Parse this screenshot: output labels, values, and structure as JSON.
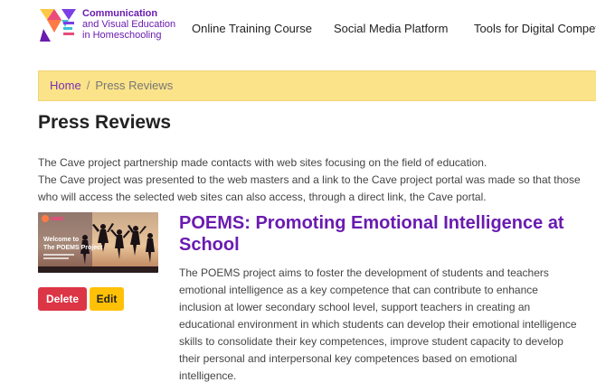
{
  "header": {
    "logo": {
      "line1": "Communication",
      "line2": "and Visual Education",
      "line3": "in Homeschooling"
    },
    "nav": [
      {
        "label": "Online Training Course"
      },
      {
        "label": "Social Media Platform"
      },
      {
        "label": "Tools for Digital Compete"
      }
    ]
  },
  "breadcrumb": {
    "home": "Home",
    "separator": "/",
    "current": "Press Reviews"
  },
  "page": {
    "title": "Press Reviews",
    "intro": [
      "The Cave project partnership made contacts with web sites focusing on the field of education.",
      "The Cave project was presented to the web masters and a link to the Cave project portal was made so that those who will access the selected web sites can also access, through a direct link, the Cave portal."
    ]
  },
  "article": {
    "thumbnail": {
      "text_line1": "Welcome to",
      "text_line2": "The POEMS Project"
    },
    "title": "POEMS: Promoting Emotional Intelligence at School",
    "body": "The POEMS project aims to foster the development of students and teachers emotional intelligence as a key competence that can contribute to enhance inclusion at lower secondary school level, support teachers in creating an educational environment in which students can develop their emotional intelligence skills to consolidate their key competences, improve student capacity to develop their personal and interpersonal key competences based on emotional intelligence.",
    "delete_label": "Delete",
    "edit_label": "Edit"
  },
  "colors": {
    "brand_purple": "#6a1bb0",
    "breadcrumb_bg": "#fbe389",
    "delete_red": "#dc3545",
    "edit_yellow": "#ffc107"
  }
}
